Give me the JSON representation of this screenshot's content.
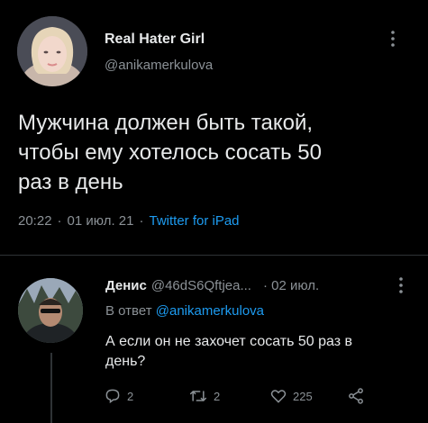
{
  "tweet": {
    "author_name": "Real Hater Girl",
    "author_handle": "@anikamerkulova",
    "text_line1": "Мужчина должен быть такой,",
    "text_line2": "чтобы ему хотелось сосать 50",
    "text_line3": "раз в день",
    "time": "20:22",
    "date": "01 июл. 21",
    "client": "Twitter for iPad"
  },
  "reply": {
    "author_name": "Денис",
    "author_handle": "@46dS6Qftjea...",
    "date": "· 02 июл.",
    "replying_prefix": "В ответ",
    "replying_to": "@anikamerkulova",
    "text_line1": "А если он не захочет сосать 50 раз в",
    "text_line2": "день?",
    "reply_count": "2",
    "retweet_count": "2",
    "like_count": "225"
  },
  "colors": {
    "background": "#000000",
    "text": "#e7e9ea",
    "secondary": "#8b9196",
    "accent": "#1d9bf0"
  },
  "icons": [
    "more-icon",
    "reply-icon",
    "retweet-icon",
    "like-icon",
    "share-icon"
  ]
}
